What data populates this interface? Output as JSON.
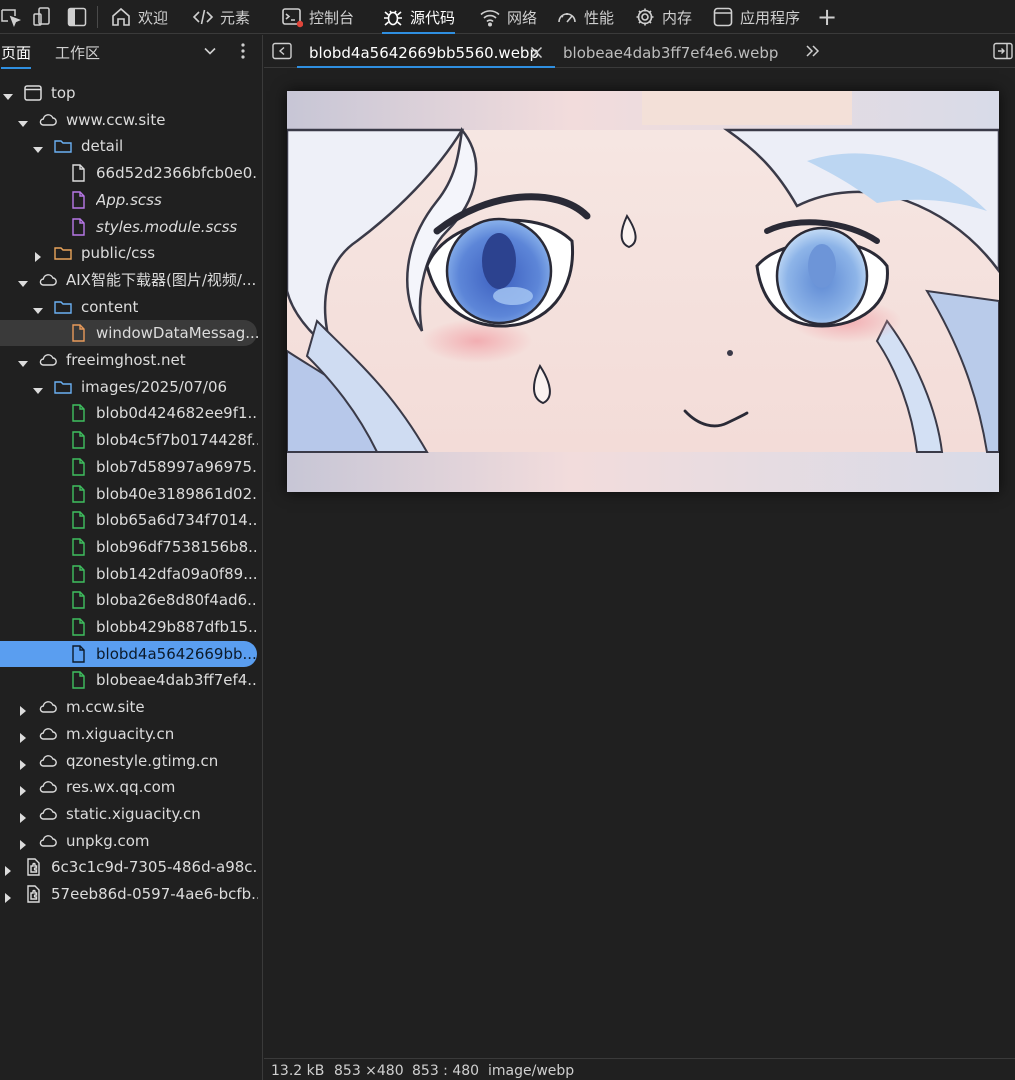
{
  "toolbar": {
    "tabs": [
      {
        "label": "欢迎",
        "icon": "home-icon"
      },
      {
        "label": "元素",
        "icon": "code-icon"
      },
      {
        "label": "控制台",
        "icon": "console-icon"
      },
      {
        "label": "源代码",
        "icon": "bug-icon",
        "active": true
      },
      {
        "label": "网络",
        "icon": "wifi-icon"
      },
      {
        "label": "性能",
        "icon": "gauge-icon"
      },
      {
        "label": "内存",
        "icon": "gear-icon"
      },
      {
        "label": "应用程序",
        "icon": "window-icon"
      }
    ],
    "add_label": "+"
  },
  "left_panel": {
    "tabs": [
      "页面",
      "工作区"
    ],
    "active_tab": "页面"
  },
  "tree": [
    {
      "label": "top",
      "type": "frame",
      "expanded": true
    },
    {
      "label": "www.ccw.site",
      "type": "cloud",
      "expanded": true
    },
    {
      "label": "detail",
      "type": "folder",
      "expanded": true
    },
    {
      "label": "66d52d2366bfcb0e0...",
      "type": "file"
    },
    {
      "label": "App.scss",
      "type": "file-style",
      "italic": true
    },
    {
      "label": "styles.module.scss",
      "type": "file-style",
      "italic": true
    },
    {
      "label": "public/css",
      "type": "folder-orange",
      "expanded": false
    },
    {
      "label": "AIX智能下载器(图片/视频/...",
      "type": "cloud",
      "expanded": true
    },
    {
      "label": "content",
      "type": "folder",
      "expanded": true
    },
    {
      "label": "windowDataMessag...",
      "type": "file-script"
    },
    {
      "label": "freeimghost.net",
      "type": "cloud",
      "expanded": true
    },
    {
      "label": "images/2025/07/06",
      "type": "folder",
      "expanded": true
    },
    {
      "label": "blob0d424682ee9f1...",
      "type": "file-image"
    },
    {
      "label": "blob4c5f7b0174428f...",
      "type": "file-image"
    },
    {
      "label": "blob7d58997a96975...",
      "type": "file-image"
    },
    {
      "label": "blob40e3189861d02...",
      "type": "file-image"
    },
    {
      "label": "blob65a6d734f7014...",
      "type": "file-image"
    },
    {
      "label": "blob96df7538156b8...",
      "type": "file-image"
    },
    {
      "label": "blob142dfa09a0f89...",
      "type": "file-image"
    },
    {
      "label": "bloba26e8d80f4ad6...",
      "type": "file-image"
    },
    {
      "label": "blobb429b887dfb15...",
      "type": "file-image"
    },
    {
      "label": "blobd4a5642669bb...",
      "type": "file-plain",
      "selected": true
    },
    {
      "label": "blobeae4dab3ff7ef4...",
      "type": "file-image"
    },
    {
      "label": "m.ccw.site",
      "type": "cloud",
      "expanded": false
    },
    {
      "label": "m.xiguacity.cn",
      "type": "cloud",
      "expanded": false
    },
    {
      "label": "qzonestyle.gtimg.cn",
      "type": "cloud",
      "expanded": false
    },
    {
      "label": "res.wx.qq.com",
      "type": "cloud",
      "expanded": false
    },
    {
      "label": "static.xiguacity.cn",
      "type": "cloud",
      "expanded": false
    },
    {
      "label": "unpkg.com",
      "type": "cloud",
      "expanded": false
    },
    {
      "label": "6c3c1c9d-7305-486d-a98c...",
      "type": "extension",
      "expanded": false
    },
    {
      "label": "57eeb86d-0597-4ae6-bcfb...",
      "type": "extension",
      "expanded": false
    }
  ],
  "editor": {
    "tabs": [
      {
        "label": "blobd4a5642669bb5560.webp",
        "active": true
      },
      {
        "label": "blobeae4dab3ff7ef4e6.webp",
        "active": false
      }
    ]
  },
  "status": {
    "size": "13.2 kB",
    "dimensions": "853 ×480",
    "ratio": "853 : 480",
    "mime": "image/webp"
  },
  "colors": {
    "accent": "#2f8fe0",
    "selected_row": "#5a9ef0",
    "folder_blue": "#6ab0f3",
    "folder_orange": "#e8a35a",
    "file_image": "#3fbf5f",
    "file_style": "#b878e8",
    "file_script": "#e89a5a"
  }
}
